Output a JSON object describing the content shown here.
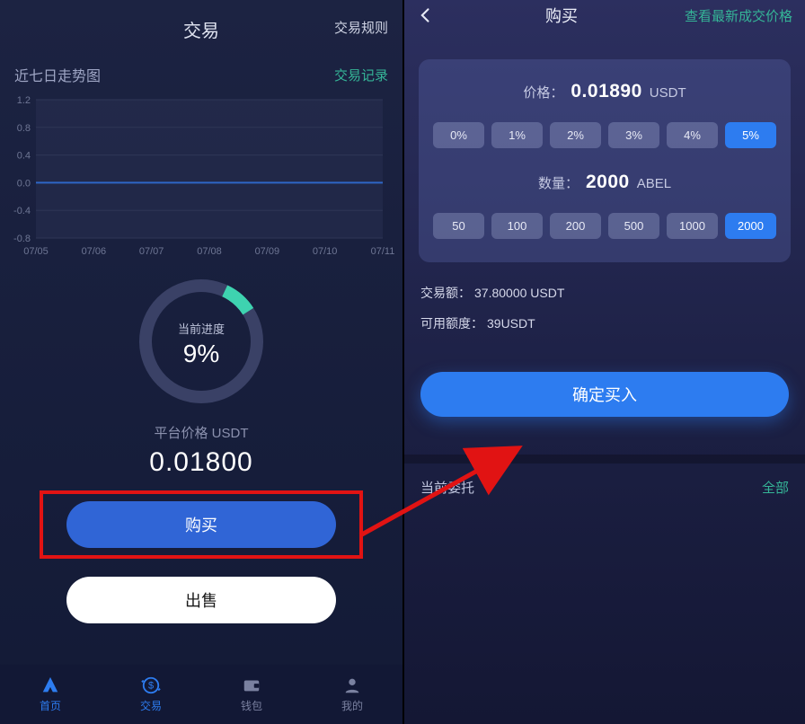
{
  "left": {
    "header": {
      "title": "交易",
      "rules": "交易规则"
    },
    "trend": {
      "label": "近七日走势图",
      "link": "交易记录"
    },
    "ring": {
      "label": "当前进度",
      "value": "9%",
      "percent": 9
    },
    "price": {
      "label": "平台价格 USDT",
      "value": "0.01800"
    },
    "buttons": {
      "buy": "购买",
      "sell": "出售"
    },
    "nav": [
      {
        "name": "home",
        "label": "首页"
      },
      {
        "name": "trade",
        "label": "交易"
      },
      {
        "name": "wallet",
        "label": "钱包"
      },
      {
        "name": "me",
        "label": "我的"
      }
    ]
  },
  "right": {
    "header": {
      "title": "购买",
      "link": "查看最新成交价格"
    },
    "price": {
      "label": "价格：",
      "value": "0.01890",
      "unit": "USDT"
    },
    "percent_chips": [
      "0%",
      "1%",
      "2%",
      "3%",
      "4%",
      "5%"
    ],
    "percent_active": 5,
    "qty": {
      "label": "数量：",
      "value": "2000",
      "unit": "ABEL"
    },
    "qty_chips": [
      "50",
      "100",
      "200",
      "500",
      "1000",
      "2000"
    ],
    "qty_active": 5,
    "info": {
      "amount_label": "交易额：",
      "amount_value": "37.80000 USDT",
      "avail_label": "可用额度：",
      "avail_value": "39USDT"
    },
    "confirm": "确定买入",
    "orders": {
      "label": "当前委托",
      "all": "全部"
    }
  },
  "chart_data": {
    "type": "line",
    "title": "近七日走势图",
    "xlabel": "",
    "ylabel": "",
    "categories": [
      "07/05",
      "07/06",
      "07/07",
      "07/08",
      "07/09",
      "07/10",
      "07/11"
    ],
    "values": [
      0.0,
      0.0,
      0.0,
      0.0,
      0.0,
      0.0,
      0.0
    ],
    "yticks": [
      -0.8,
      -0.4,
      0.0,
      0.4,
      0.8,
      1.2
    ],
    "ylim": [
      -0.8,
      1.2
    ]
  }
}
